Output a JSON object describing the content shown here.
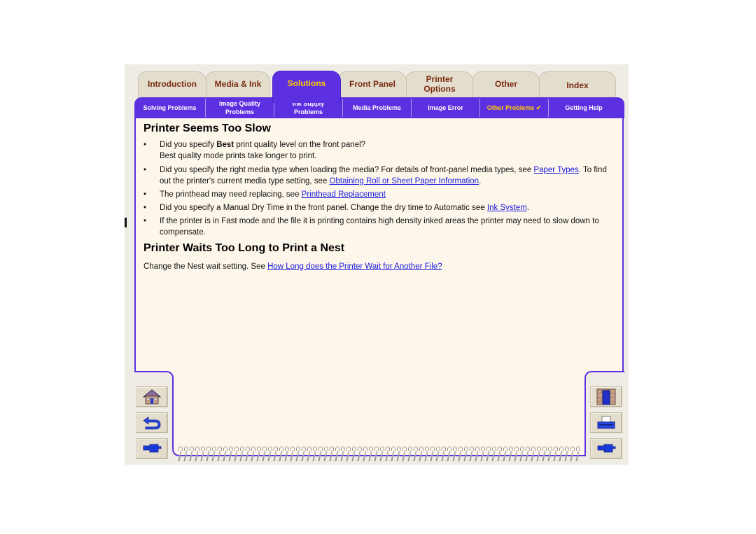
{
  "tabs": [
    {
      "label": "Introduction",
      "active": false
    },
    {
      "label": "Media & Ink",
      "active": false
    },
    {
      "label": "Solutions",
      "active": true
    },
    {
      "label": "Front Panel",
      "active": false
    },
    {
      "label": "Printer Options",
      "active": false
    },
    {
      "label": "Other",
      "active": false
    },
    {
      "label": "Index",
      "active": false
    }
  ],
  "subnav": [
    {
      "label": "Solving Problems",
      "active": false
    },
    {
      "label": "Image Quality Problems",
      "active": false
    },
    {
      "label": "Ink Supply Problems",
      "active": false
    },
    {
      "label": "Media Problems",
      "active": false
    },
    {
      "label": "Image Error",
      "active": false
    },
    {
      "label": "Other Problems ✔",
      "active": true
    },
    {
      "label": "Getting Help",
      "active": false
    }
  ],
  "section1": {
    "title": "Printer Seems Too Slow",
    "bullets": [
      {
        "pre": "Did you specify ",
        "bold": "Best",
        "post": " print quality level on the front panel?",
        "line2": "Best quality mode prints take longer to print."
      },
      {
        "pre": "Did you specify the right media type when loading the media? For details of front-panel media types, see ",
        "link1": "Paper Types",
        "mid": ". To find out the printer's current media type setting, see ",
        "link2": "Obtaining Roll or Sheet Paper Information",
        "post": "."
      },
      {
        "pre": "The printhead may need replacing, see ",
        "link1": "Printhead Replacement"
      },
      {
        "pre": "Did you specify a Manual Dry Time in the front panel. Change the dry time to Automatic see ",
        "link1": "Ink System",
        "post": "."
      },
      {
        "pre": "If the printer is in Fast mode and the file it is printing contains high density inked areas the printer may need to slow down to compensate."
      }
    ]
  },
  "section2": {
    "title": "Printer Waits Too Long to Print a Nest",
    "pre": "Change the Nest wait setting. See ",
    "link": "How Long does the Printer Wait for Another File?"
  },
  "bullet_char": "•",
  "nav_left": [
    "home-icon",
    "back-icon",
    "next-page-icon"
  ],
  "nav_right": [
    "exit-door-icon",
    "printer-icon",
    "previous-page-icon"
  ]
}
